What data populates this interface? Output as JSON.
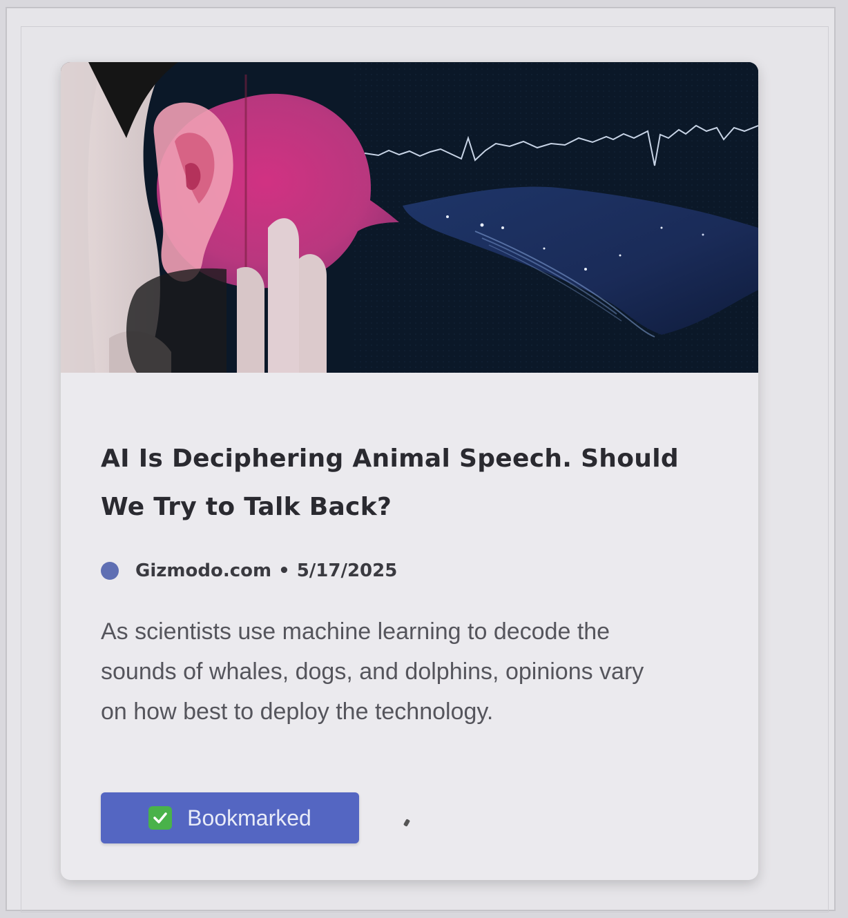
{
  "article": {
    "image_alt": "Human ear with pink speech bubble and soundwave connecting to a whale in dark ocean",
    "title": "AI Is Deciphering Animal Speech. Should We Try to Talk Back?",
    "source": "Gizmodo.com",
    "separator": "•",
    "date": "5/17/2025",
    "summary": "As scientists use machine learning to decode the sounds of whales, dogs, and dolphins, opinions vary on how best to deploy the technology.",
    "source_icon": "source-dot-icon",
    "source_color": "#5f6fb3"
  },
  "bookmark": {
    "label": "Bookmarked",
    "icon": "checkbox-checked-icon",
    "button_color": "#5466c2",
    "check_color": "#49b24a"
  }
}
